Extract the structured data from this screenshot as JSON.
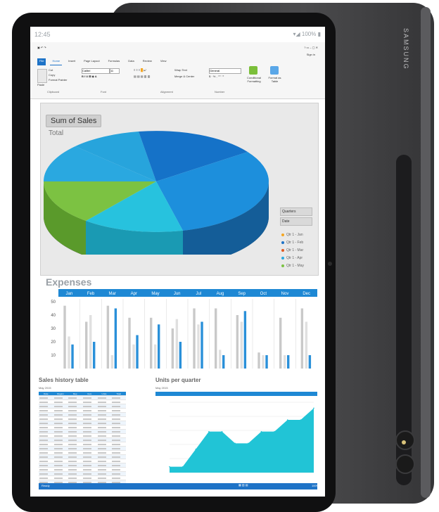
{
  "device": {
    "brand": "SAMSUNG",
    "status": {
      "time": "12:45",
      "battery": "100%"
    }
  },
  "ribbon": {
    "tabs": [
      "File",
      "Home",
      "Insert",
      "Page Layout",
      "Formulas",
      "Data",
      "Review",
      "View"
    ],
    "active_tab": "Home",
    "groups": [
      "Clipboard",
      "Font",
      "Alignment",
      "Number"
    ],
    "clipboard_items": [
      "Paste",
      "Cut",
      "Copy",
      "Format Painter"
    ],
    "font_name": "Calibri",
    "font_size": "11",
    "wrap_text": "Wrap Text",
    "merge_center": "Merge & Center",
    "number_format": "General",
    "conditional_formatting": "Conditional Formatting",
    "format_as_table": "Format as Table",
    "sign_in": "Sign in"
  },
  "pie": {
    "title": "Sum of Sales",
    "subtitle": "Total",
    "slicers": [
      "Quarters",
      "Date"
    ],
    "legend": [
      {
        "label": "Qtr 1 - Jan",
        "color": "#f5a623"
      },
      {
        "label": "Qtr 1 - Feb",
        "color": "#1e73c7"
      },
      {
        "label": "Qtr 1 - Mar",
        "color": "#e05a22"
      },
      {
        "label": "Qtr 1 - Apr",
        "color": "#2aa8e0"
      },
      {
        "label": "Qtr 1 - May",
        "color": "#7cc242"
      }
    ]
  },
  "expenses": {
    "title": "Expenses",
    "months": [
      "Jan",
      "Feb",
      "Mar",
      "Apr",
      "May",
      "Jun",
      "Jul",
      "Aug",
      "Sep",
      "Oct",
      "Nov",
      "Dec"
    ],
    "yticks": [
      50,
      40,
      30,
      20,
      10
    ],
    "gray_bars": [
      47,
      35,
      47,
      38,
      38,
      30,
      45,
      45,
      40,
      12,
      38,
      45
    ],
    "light_bars": [
      24,
      40,
      10,
      18,
      18,
      37,
      33,
      14,
      35,
      10,
      10,
      35
    ],
    "blue_bars": [
      18,
      20,
      45,
      25,
      33,
      20,
      35,
      10,
      43,
      10,
      10,
      10
    ]
  },
  "sales_table": {
    "title": "Sales history table",
    "subtitle": "May 2015",
    "headers": [
      "Date",
      "Region",
      "Rep",
      "Item",
      "Units",
      "Total"
    ]
  },
  "units": {
    "title": "Units per quarter",
    "subtitle": "May 2015",
    "values": [
      5,
      5,
      20,
      35,
      35,
      25,
      25,
      35,
      35,
      45,
      45,
      55
    ]
  },
  "footer": {
    "left": "Ready",
    "right": "100%"
  },
  "colors": {
    "accent": "#1e73c7",
    "teal": "#21c4d6"
  }
}
